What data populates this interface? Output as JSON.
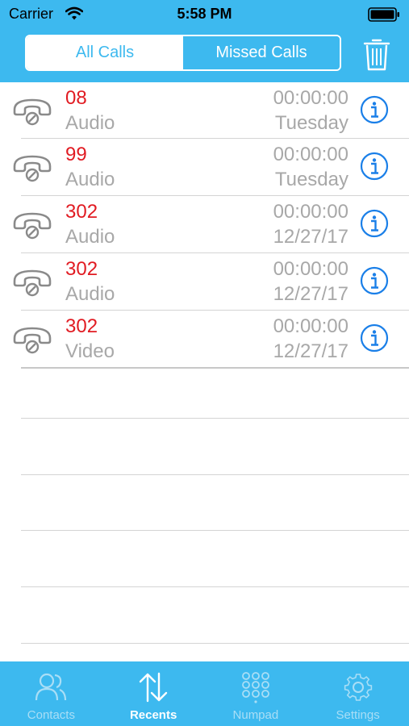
{
  "status_bar": {
    "carrier": "Carrier",
    "time": "5:58 PM"
  },
  "header": {
    "segments": [
      {
        "label": "All Calls",
        "selected": true
      },
      {
        "label": "Missed Calls",
        "selected": false
      }
    ],
    "trash_icon": "trash-icon"
  },
  "calls": [
    {
      "number": "08",
      "type": "Audio",
      "duration": "00:00:00",
      "date": "Tuesday",
      "icon": "missed-call-icon"
    },
    {
      "number": "99",
      "type": "Audio",
      "duration": "00:00:00",
      "date": "Tuesday",
      "icon": "missed-call-icon"
    },
    {
      "number": "302",
      "type": "Audio",
      "duration": "00:00:00",
      "date": "12/27/17",
      "icon": "missed-call-icon"
    },
    {
      "number": "302",
      "type": "Audio",
      "duration": "00:00:00",
      "date": "12/27/17",
      "icon": "missed-call-icon"
    },
    {
      "number": "302",
      "type": "Video",
      "duration": "00:00:00",
      "date": "12/27/17",
      "icon": "missed-call-icon"
    }
  ],
  "tabbar": {
    "tabs": [
      {
        "label": "Contacts",
        "icon": "contacts-icon",
        "active": false
      },
      {
        "label": "Recents",
        "icon": "recents-icon",
        "active": true
      },
      {
        "label": "Numpad",
        "icon": "numpad-icon",
        "active": false
      },
      {
        "label": "Settings",
        "icon": "settings-icon",
        "active": false
      }
    ]
  },
  "colors": {
    "accent": "#3db9ef",
    "missed": "#e11b22",
    "info": "#1a7fe8",
    "muted": "#a8a8a8"
  }
}
